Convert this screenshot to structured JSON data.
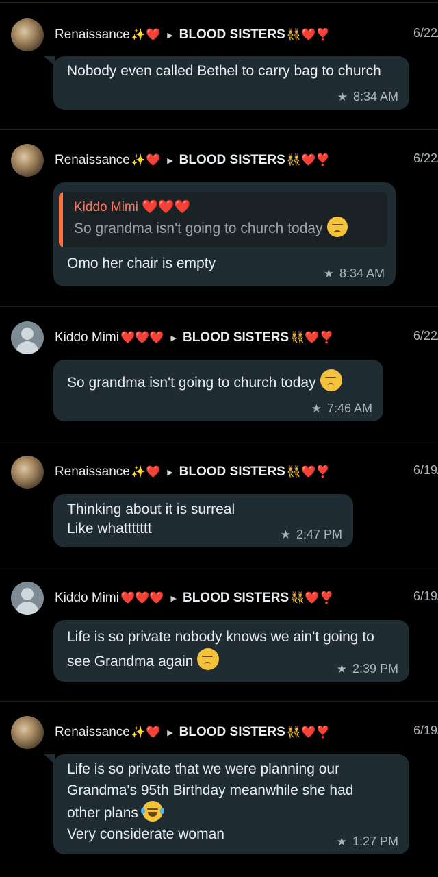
{
  "messages": [
    {
      "sender": "Renaissance",
      "sender_emoji": "✨❤️",
      "group": "BLOOD SISTERS",
      "group_emoji": "👯❤️❣️",
      "date": "6/22/",
      "text": "Nobody even called Bethel to carry bag to church",
      "time": "8:34 AM",
      "starred": true
    },
    {
      "sender": "Renaissance",
      "sender_emoji": "✨❤️",
      "group": "BLOOD SISTERS",
      "group_emoji": "👯❤️❣️",
      "date": "6/22/",
      "quote": {
        "name": "Kiddo Mimi ❤️❤️❤️",
        "text": "So grandma isn't going to church today"
      },
      "text": "Omo her chair is empty",
      "time": "8:34 AM",
      "starred": true
    },
    {
      "sender": "Kiddo Mimi",
      "sender_emoji": "❤️❤️❤️",
      "group": "BLOOD SISTERS",
      "group_emoji": "👯❤️❣️",
      "date": "6/22/",
      "text": "So grandma isn't going to church today",
      "time": "7:46 AM",
      "starred": true
    },
    {
      "sender": "Renaissance",
      "sender_emoji": "✨❤️",
      "group": "BLOOD SISTERS",
      "group_emoji": "👯❤️❣️",
      "date": "6/19/",
      "text": "Thinking about it is surreal\nLike whattttttt",
      "time": "2:47 PM",
      "starred": true
    },
    {
      "sender": "Kiddo Mimi",
      "sender_emoji": "❤️❤️❤️",
      "group": "BLOOD SISTERS",
      "group_emoji": "👯❤️❣️",
      "date": "6/19/",
      "text": "Life is so private nobody knows we ain't going to see Grandma again",
      "time": "2:39 PM",
      "starred": true
    },
    {
      "sender": "Renaissance",
      "sender_emoji": "✨❤️",
      "group": "BLOOD SISTERS",
      "group_emoji": "👯❤️❣️",
      "date": "6/19/",
      "text": "Life is so private that we were planning our Grandma's 95th Birthday meanwhile she had other plans",
      "text2": "Very considerate woman",
      "time": "1:27 PM",
      "starred": true
    }
  ],
  "icons": {
    "star": "star-icon",
    "arrow": "right-triangle-icon",
    "pensive_emoji": "pensive-face-emoji",
    "laugh_emoji": "face-with-tears-of-joy-emoji"
  },
  "colors": {
    "background": "#000000",
    "bubble": "#202c33",
    "quote_bar": "#ff6f3c",
    "quote_name": "#ff7a5c"
  }
}
